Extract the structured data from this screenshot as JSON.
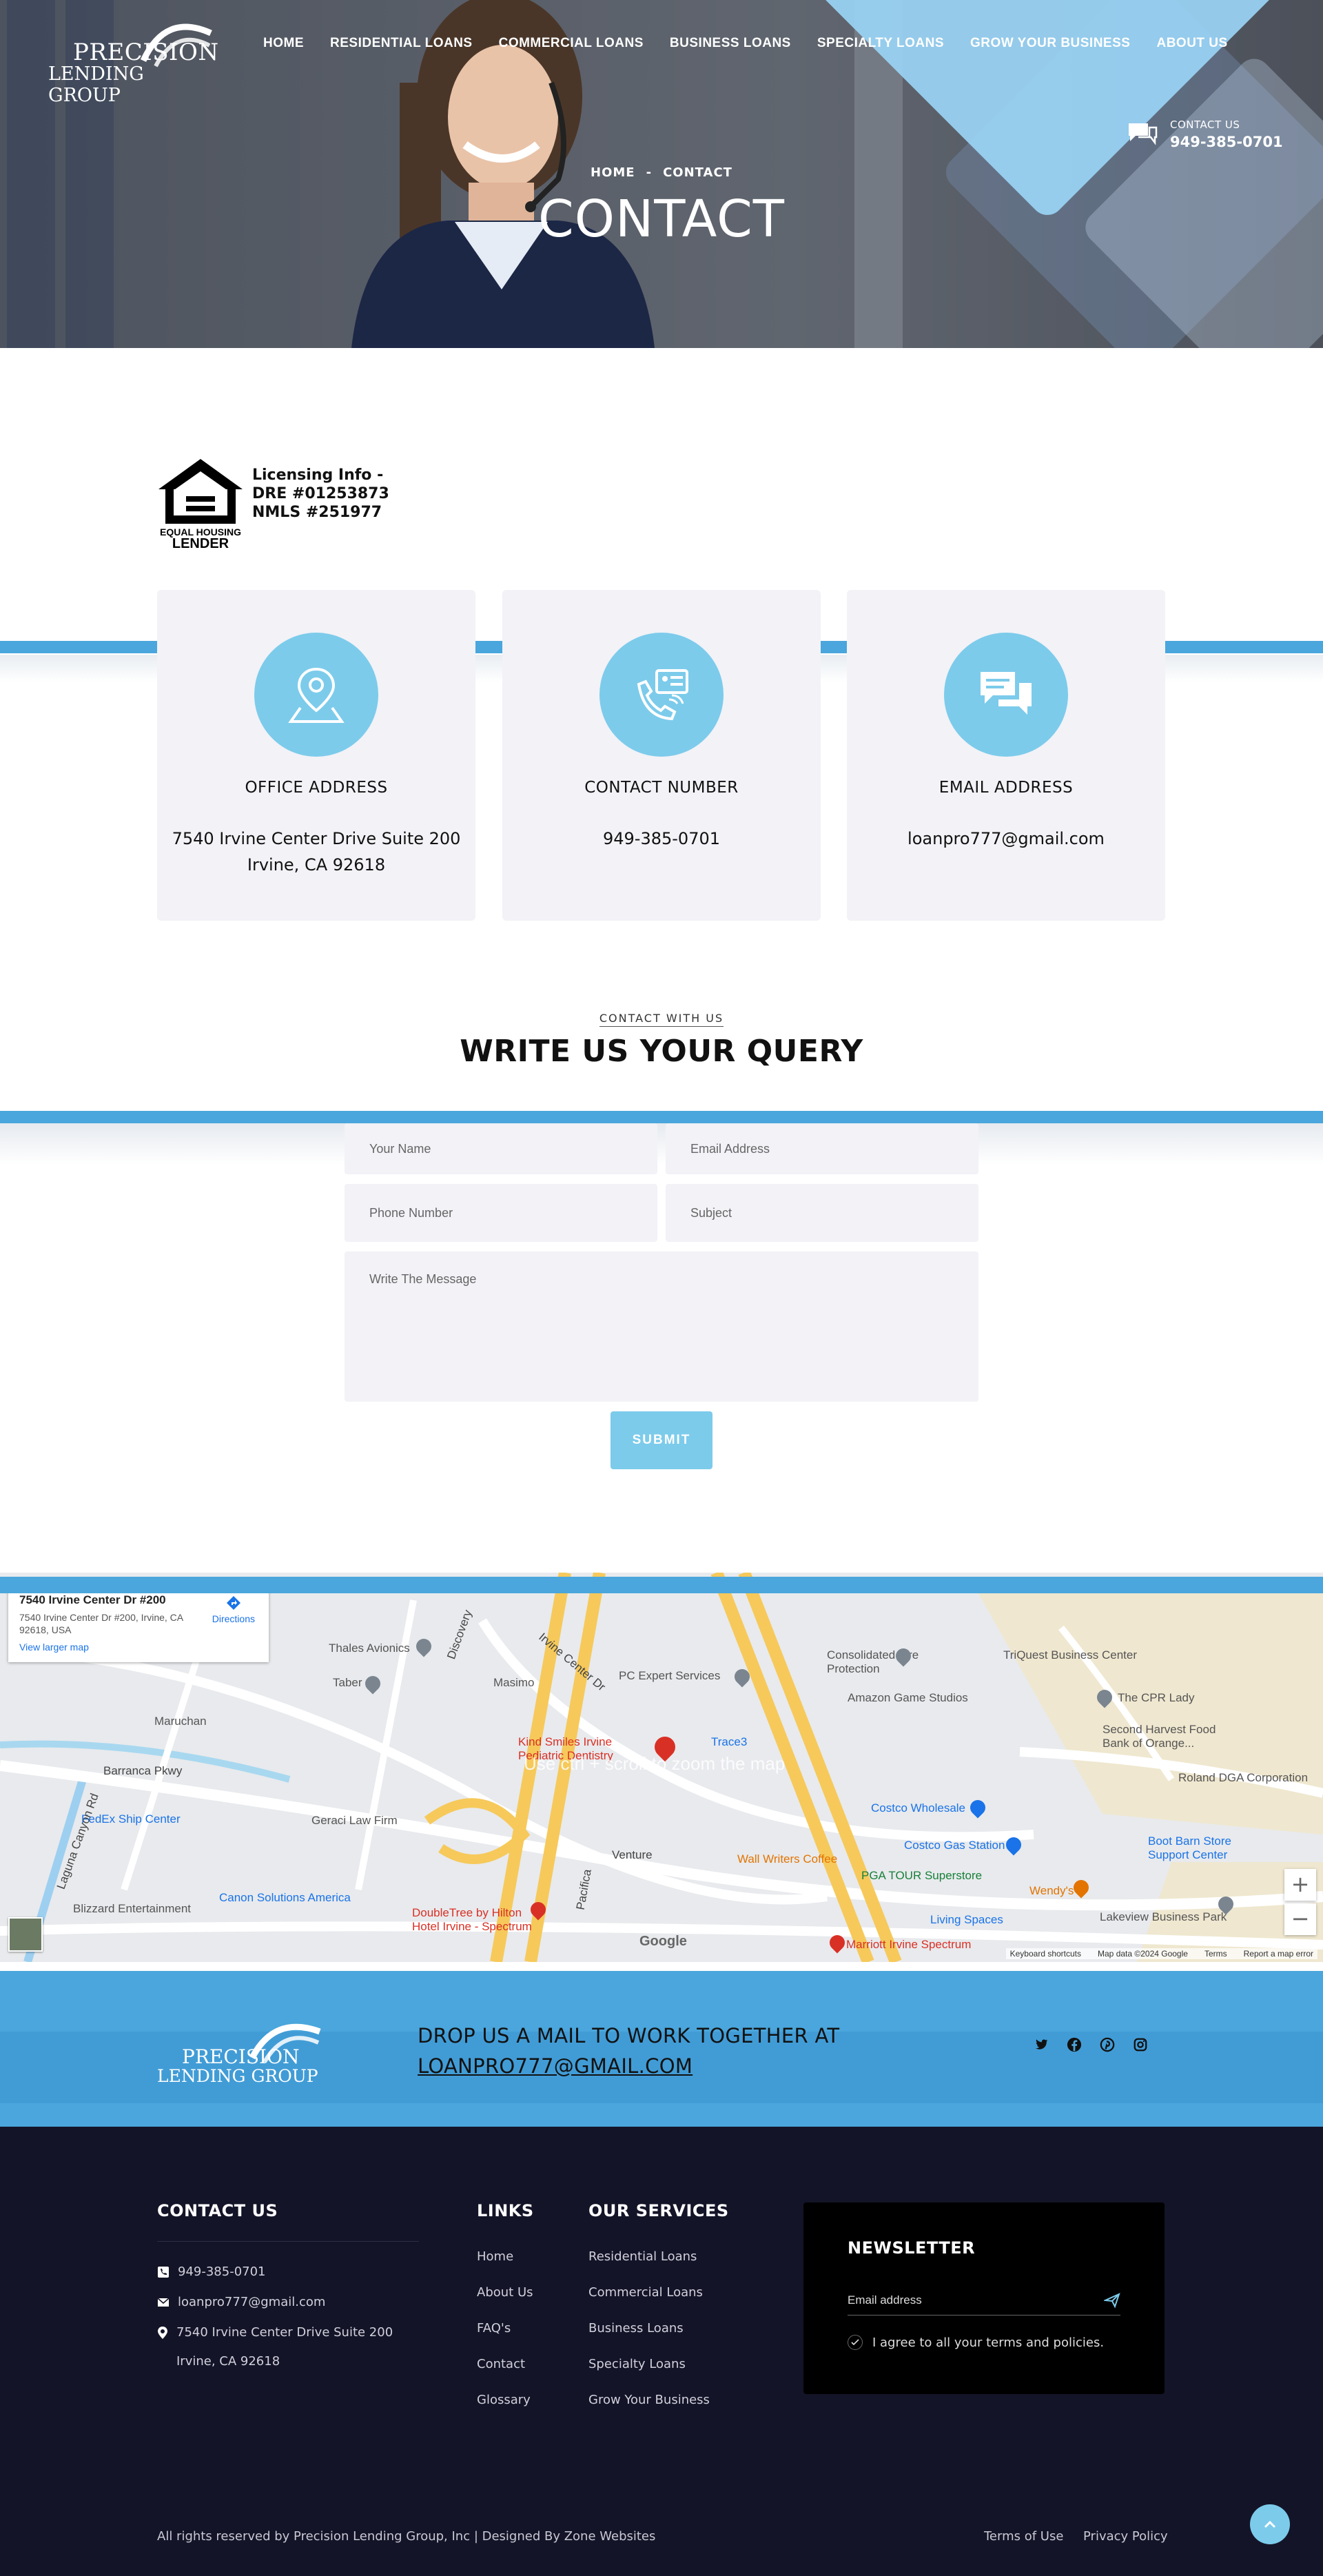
{
  "brand": {
    "line1": "PRECISION",
    "line2": "LENDING GROUP"
  },
  "nav": [
    {
      "label": "HOME"
    },
    {
      "label": "RESIDENTIAL LOANS"
    },
    {
      "label": "COMMERCIAL LOANS"
    },
    {
      "label": "BUSINESS LOANS"
    },
    {
      "label": "SPECIALTY LOANS"
    },
    {
      "label": "GROW YOUR BUSINESS"
    },
    {
      "label": "ABOUT US"
    }
  ],
  "header_contact": {
    "label": "CONTACT US",
    "phone": "949-385-0701",
    "icon": "chat-icon"
  },
  "breadcrumb": {
    "home": "HOME",
    "sep": "-",
    "current": "CONTACT"
  },
  "hero": {
    "title": "CONTACT"
  },
  "license": {
    "logo_text1": "EQUAL HOUSING",
    "logo_text2": "LENDER",
    "line1": "Licensing Info -",
    "line2": "DRE #01253873",
    "line3": "NMLS #251977"
  },
  "cards": [
    {
      "icon": "map-pin-icon",
      "title": "OFFICE ADDRESS",
      "line1": "7540 Irvine Center Drive Suite 200",
      "line2": "Irvine, CA 92618"
    },
    {
      "icon": "phone-card-icon",
      "title": "CONTACT NUMBER",
      "line1": "949-385-0701",
      "line2": ""
    },
    {
      "icon": "chat-bubbles-icon",
      "title": "EMAIL ADDRESS",
      "line1": "loanpro777@gmail.com",
      "line2": ""
    }
  ],
  "form": {
    "eyebrow": "CONTACT WITH US",
    "title": "WRITE US YOUR QUERY",
    "name_placeholder": "Your Name",
    "email_placeholder": "Email Address",
    "phone_placeholder": "Phone Number",
    "subject_placeholder": "Subject",
    "message_placeholder": "Write The Message",
    "submit": "SUBMIT"
  },
  "map": {
    "info_title": "7540 Irvine Center Dr #200",
    "info_address": "7540 Irvine Center Dr #200, Irvine, CA 92618, USA",
    "directions": "Directions",
    "larger": "View larger map",
    "scroll_hint": "Use ctrl + scroll to zoom the map",
    "labels": [
      "Thales Avionics",
      "Taber",
      "Masimo",
      "PC Expert Services",
      "Consolidated Fire Protection",
      "TriQuest Business Center",
      "Amazon Game Studios",
      "The CPR Lady",
      "Second Harvest Food Bank of Orange...",
      "Maruchan",
      "Kind Smiles Irvine Pediatric Dentistry",
      "Trace3",
      "Roland DGA Corporation",
      "Barranca Pkwy",
      "FedEx Ship Center",
      "Geraci Law Firm",
      "Costco Wholesale",
      "Boot Barn Store Support Center",
      "Costco Gas Station",
      "Wall Writers Coffee",
      "PGA TOUR Superstore",
      "Wendy's",
      "Canon Solutions America",
      "Blizzard Entertainment",
      "DoubleTree by Hilton Hotel Irvine - Spectrum",
      "Living Spaces",
      "Lakeview Business Park",
      "Marriott Irvine Spectrum",
      "Irvine Center Dr",
      "Discovery",
      "Venture",
      "Pacifica",
      "Laguna Canyon Rd"
    ],
    "google": "Google",
    "footer_links": [
      "Keyboard shortcuts",
      "Map data ©2024 Google",
      "Terms",
      "Report a map error"
    ],
    "zoom_in": "+",
    "zoom_out": "−"
  },
  "cta": {
    "line1": "DROP US A MAIL TO WORK TOGETHER AT",
    "email": "LOANPRO777@GMAIL.COM",
    "social": [
      "twitter-icon",
      "facebook-icon",
      "pinterest-icon",
      "instagram-icon"
    ]
  },
  "footer": {
    "contact_heading": "CONTACT US",
    "phone": "949-385-0701",
    "email": "loanpro777@gmail.com",
    "address1": "7540 Irvine Center Drive Suite 200",
    "address2": "Irvine, CA 92618",
    "links_heading": "LINKS",
    "links": [
      "Home",
      "About Us",
      "FAQ's",
      "Contact",
      "Glossary"
    ],
    "services_heading": "OUR SERVICES",
    "services": [
      "Residential Loans",
      "Commercial Loans",
      "Business Loans",
      "Specialty Loans",
      "Grow Your Business"
    ],
    "newsletter_heading": "NEWSLETTER",
    "newsletter_placeholder": "Email address",
    "agree": "I agree to all your terms and policies.",
    "copyright": "All rights reserved by Precision Lending Group, Inc | Designed By Zone Websites",
    "terms": "Terms of Use",
    "privacy": "Privacy Policy"
  },
  "colors": {
    "accent": "#4aa6dc",
    "light_accent": "#7ccbeb",
    "card_bg": "#f2f2f7",
    "footer_bg": "#141428"
  }
}
